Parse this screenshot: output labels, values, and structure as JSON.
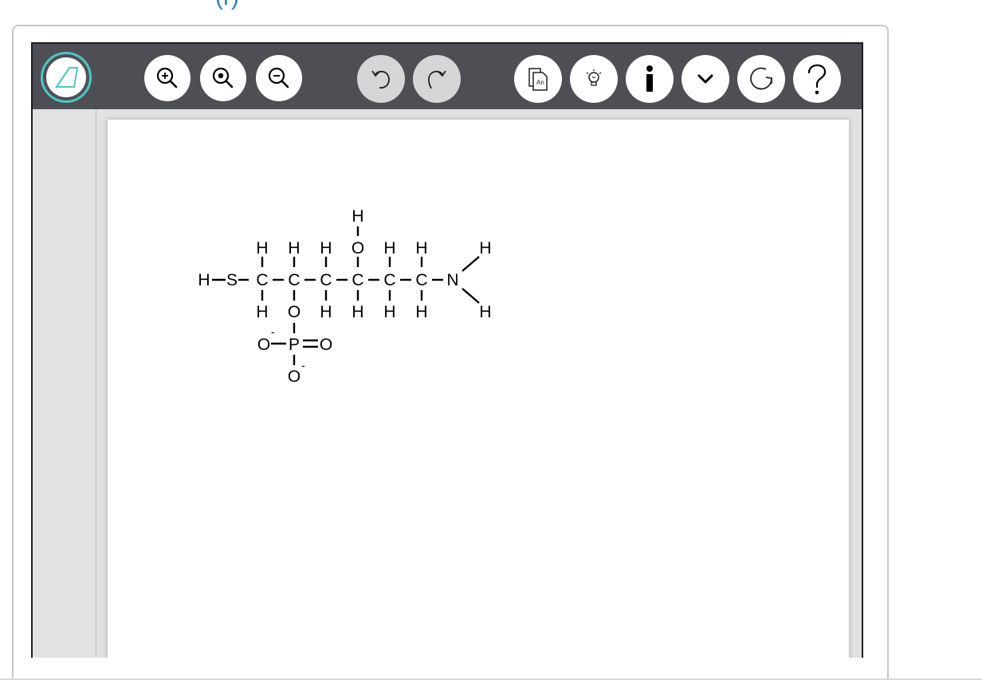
{
  "header_fragment": "(r)",
  "toolbar": {
    "buttons": [
      {
        "id": "draw",
        "icon": "pen-icon",
        "label": "Draw"
      },
      {
        "id": "zoom-in",
        "icon": "zoom-in-icon",
        "label": "Zoom in"
      },
      {
        "id": "zoom-reset",
        "icon": "zoom-reset-icon",
        "label": "Reset zoom"
      },
      {
        "id": "zoom-out",
        "icon": "zoom-out-icon",
        "label": "Zoom out"
      },
      {
        "id": "undo",
        "icon": "undo-icon",
        "label": "Undo",
        "disabled": true
      },
      {
        "id": "redo",
        "icon": "redo-icon",
        "label": "Redo",
        "disabled": true
      },
      {
        "id": "templates",
        "icon": "document-icon",
        "label": "An"
      },
      {
        "id": "hint",
        "icon": "lightbulb-icon",
        "label": "Hint"
      },
      {
        "id": "info",
        "icon": "info-icon",
        "label": "i"
      },
      {
        "id": "more",
        "icon": "chevron-down-icon",
        "label": "More"
      },
      {
        "id": "reset",
        "icon": "refresh-icon",
        "label": "Reset"
      },
      {
        "id": "help",
        "icon": "help-icon",
        "label": "?"
      }
    ]
  },
  "molecule": {
    "atoms": {
      "H": "H",
      "S": "S",
      "C": "C",
      "O": "O",
      "N": "N",
      "P": "P",
      "charge": "-"
    }
  },
  "colors": {
    "toolbar_bg": "#4e4f55",
    "accent": "#4ec6c8",
    "panel_bg": "#e2e2e2",
    "link": "#2f7fc1"
  }
}
